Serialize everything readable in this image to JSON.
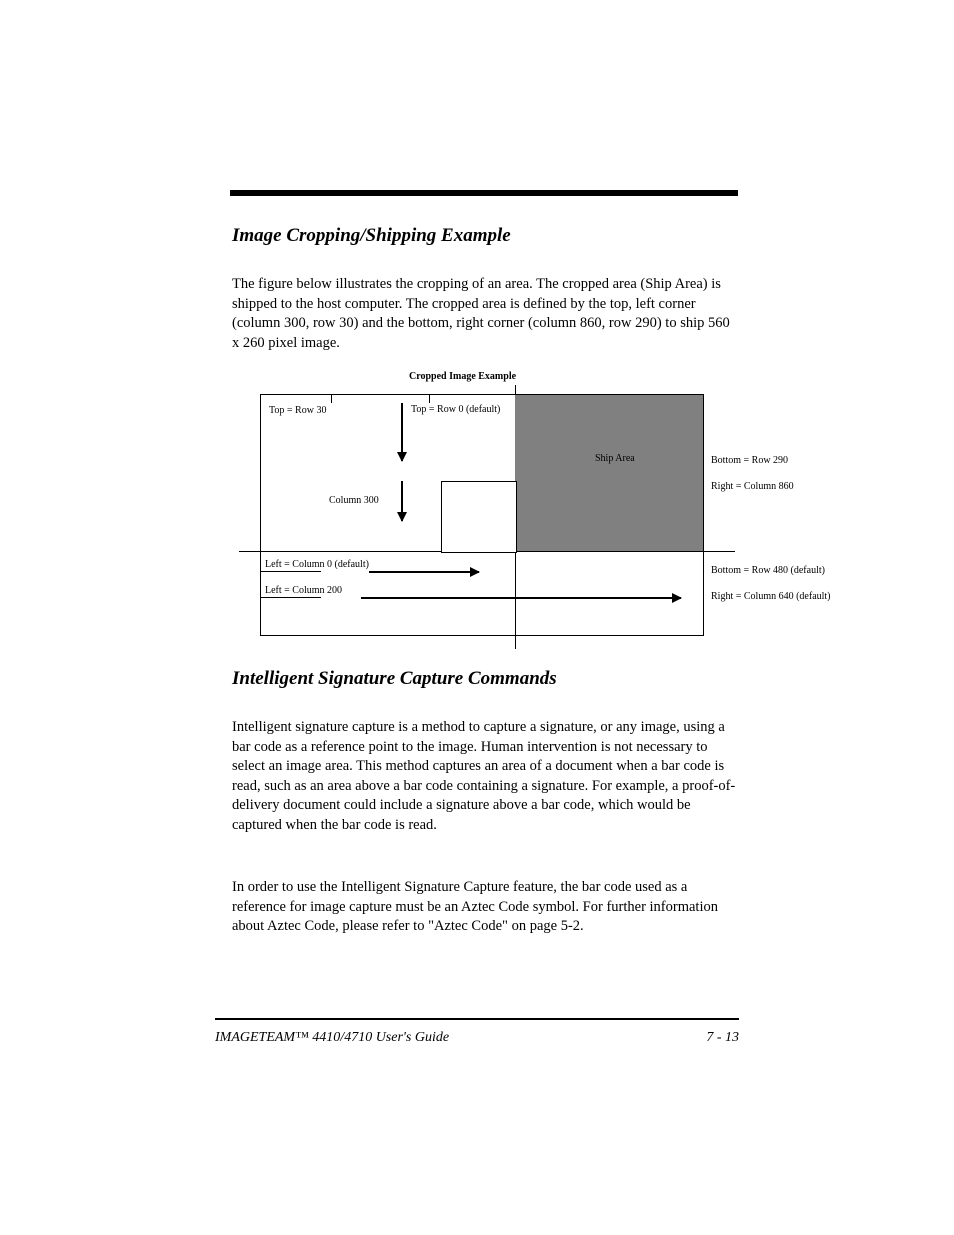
{
  "heading1": "Image Cropping/Shipping Example",
  "para1": "The figure below illustrates the cropping of an area. The cropped area (Ship Area) is shipped to the host computer. The cropped area is defined by the top, left corner (column 300, row 30) and the bottom, right corner (column 860, row 290) to ship 560 x 260 pixel image.",
  "diagram": {
    "label_top_left": "Top = Row 30",
    "label_top_right": "Top = Row 0 (default)",
    "label_inner": "Column 300",
    "label_bottom1": "Left = Column 0 (default)",
    "label_bottom2": "Left = Column 200",
    "label_right1": "Bottom = Row 290",
    "label_right2": "Right = Column 860",
    "label_right3": "Bottom = Row 480 (default)",
    "label_right4": "Right = Column 640 (default)",
    "label_title": "Cropped Image Example",
    "label_ship": "Ship Area"
  },
  "heading2": "Intelligent Signature Capture Commands",
  "para2": "Intelligent signature capture is a method to capture a signature, or any image, using a bar code as a reference point to the image. Human intervention is not necessary to select an image area. This method captures an area of a document when a bar code is read, such as an area above a bar code containing a signature. For example, a proof-of-delivery document could include a signature above a bar code, which would be captured when the bar code is read.",
  "para3": "In order to use the Intelligent Signature Capture feature, the bar code used as a reference for image capture must be an Aztec Code symbol. For further information about Aztec Code, please refer to \"Aztec Code\" on page 5-2.",
  "footer": {
    "left": "IMAGETEAM™ 4410/4710 User's Guide",
    "right": "7 - 13"
  }
}
